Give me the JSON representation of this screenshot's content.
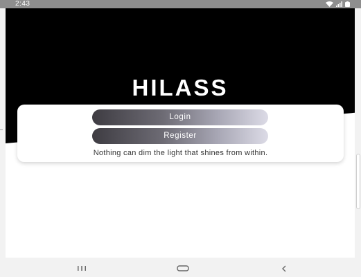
{
  "status_bar": {
    "time": "2:43",
    "icons": [
      "wifi-icon",
      "signal-icon",
      "battery-icon"
    ]
  },
  "app": {
    "title": "HILASS",
    "login_label": "Login",
    "register_label": "Register",
    "tagline": "Nothing can dim the light that shines from within."
  },
  "nav_bar": {
    "buttons": [
      "recents-icon",
      "home-icon",
      "back-icon"
    ]
  },
  "colors": {
    "status_bar": "#8e8e8e",
    "hero": "#000000",
    "button_gradient_start": "#3e3c42",
    "button_gradient_end": "#dcdbe6",
    "nav_bar": "#f2f2f2"
  }
}
